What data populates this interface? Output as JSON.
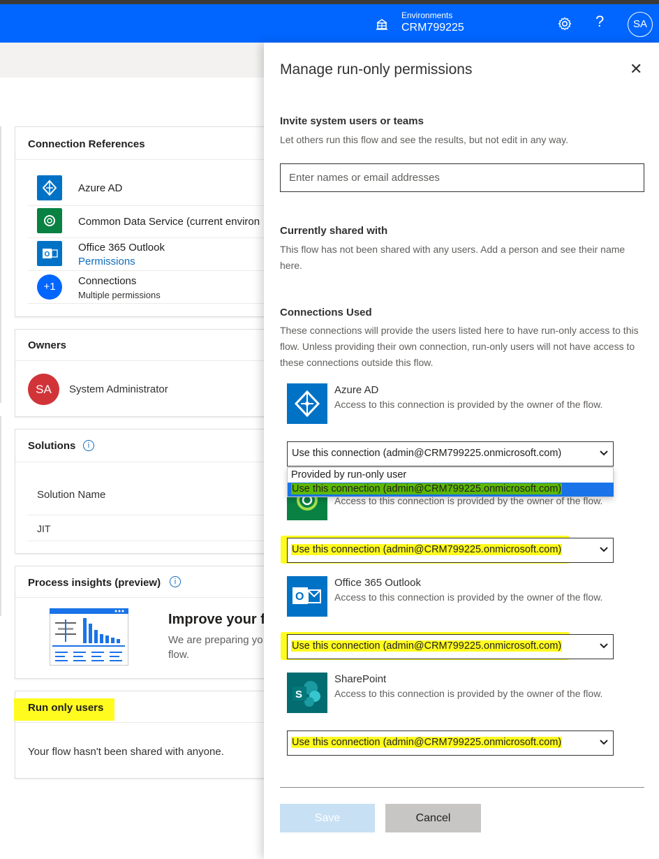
{
  "topbar": {
    "env_label": "Environments",
    "env_name": "CRM799225",
    "avatar": "SA",
    "help": "?",
    "icons": [
      "environment-icon",
      "gear-icon",
      "help-icon"
    ],
    "bg_color": "#0066ff"
  },
  "connection_references": {
    "title": "Connection References",
    "items": [
      {
        "label": "Azure AD",
        "icon": "azure-ad-icon"
      },
      {
        "label": "Common Data Service (current environ",
        "icon": "dataverse-icon"
      },
      {
        "label": "Office 365 Outlook",
        "link": "Permissions",
        "icon": "outlook-icon"
      },
      {
        "label": "Connections",
        "sub": "Multiple permissions",
        "badge": "+1"
      }
    ]
  },
  "owners": {
    "title": "Owners",
    "avatar": "SA",
    "name": "System Administrator"
  },
  "solutions": {
    "title": "Solutions",
    "column": "Solution Name",
    "rows": [
      "JIT"
    ]
  },
  "process_insights": {
    "title": "Process insights (preview)",
    "heading": "Improve your fl",
    "text_line1": "We are preparing yo",
    "text_line2": "flow."
  },
  "run_only": {
    "title": "Run only users",
    "text": "Your flow hasn't been shared with anyone."
  },
  "panel": {
    "title": "Manage run-only permissions",
    "close": "✕",
    "invite_heading": "Invite system users or teams",
    "invite_text": "Let others run this flow and see the results, but not edit in any way.",
    "invite_placeholder": "Enter names or email addresses",
    "shared_heading": "Currently shared with",
    "shared_text": "This flow has not been shared with any users. Add a person and see their name here.",
    "connections_heading": "Connections Used",
    "connections_text": "These connections will provide the users listed here to have run-only access to this flow. Unless providing their own connection, run-only users will not have access to these connections outside this flow.",
    "connections": [
      {
        "name": "Azure AD",
        "desc": "Access to this connection is provided by the owner of the flow.",
        "selected": "Use this connection (admin@CRM799225.onmicrosoft.com)",
        "icon": "azure-ad-icon"
      },
      {
        "name": "",
        "desc": "Access to this connection is provided by the owner of the flow.",
        "selected": "Use this connection (admin@CRM799225.onmicrosoft.com)",
        "icon": "dataverse-icon"
      },
      {
        "name": "Office 365 Outlook",
        "desc": "Access to this connection is provided by the owner of the flow.",
        "selected": "Use this connection (admin@CRM799225.onmicrosoft.com)",
        "icon": "outlook-icon"
      },
      {
        "name": "SharePoint",
        "desc": "Access to this connection is provided by the owner of the flow.",
        "selected": "Use this connection (admin@CRM799225.onmicrosoft.com)",
        "icon": "sharepoint-icon"
      }
    ],
    "dropdown_options": [
      "Provided by run-only user",
      "Use this connection (admin@CRM799225.onmicrosoft.com)"
    ],
    "save": "Save",
    "cancel": "Cancel"
  },
  "colors": {
    "highlight": "#fffb1f",
    "highlight_selected": "#5cb800",
    "azure_blue": "#0072c6",
    "dataverse_green": "#088142",
    "sharepoint_teal": "#036c70"
  }
}
